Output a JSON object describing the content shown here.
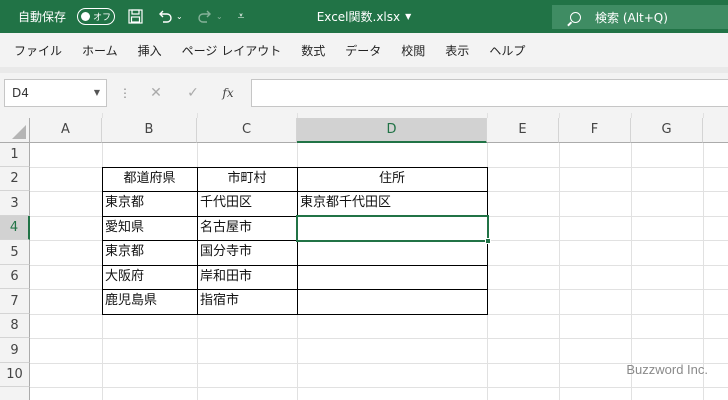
{
  "titlebar": {
    "autosave_label": "自動保存",
    "autosave_state": "オフ",
    "filename": "Excel関数.xlsx",
    "search_label": "検索 (Alt+Q)",
    "save_icon": "save-icon",
    "undo_icon": "undo-icon",
    "redo_icon": "redo-icon",
    "customize_icon": "customize-quick-access-icon"
  },
  "menu": {
    "items": [
      "ファイル",
      "ホーム",
      "挿入",
      "ページ レイアウト",
      "数式",
      "データ",
      "校閲",
      "表示",
      "ヘルプ"
    ]
  },
  "formula_bar": {
    "name_box": "D4",
    "fx_label": "fx",
    "content": ""
  },
  "sheet": {
    "columns": [
      "A",
      "B",
      "C",
      "D",
      "E",
      "F",
      "G"
    ],
    "rows": [
      "1",
      "2",
      "3",
      "4",
      "5",
      "6",
      "7",
      "8",
      "9",
      "10"
    ],
    "active_cell": "D4",
    "table": {
      "headers": [
        "都道府県",
        "市町村",
        "住所"
      ],
      "rows": [
        [
          "東京都",
          "千代田区",
          "東京都千代田区"
        ],
        [
          "愛知県",
          "名古屋市",
          ""
        ],
        [
          "東京都",
          "国分寺市",
          ""
        ],
        [
          "大阪府",
          "岸和田市",
          ""
        ],
        [
          "鹿児島県",
          "指宿市",
          ""
        ]
      ]
    }
  },
  "watermark": "Buzzword Inc.",
  "colors": {
    "accent": "#217346",
    "title_bar": "#217346",
    "search_box": "#3f8c63"
  }
}
